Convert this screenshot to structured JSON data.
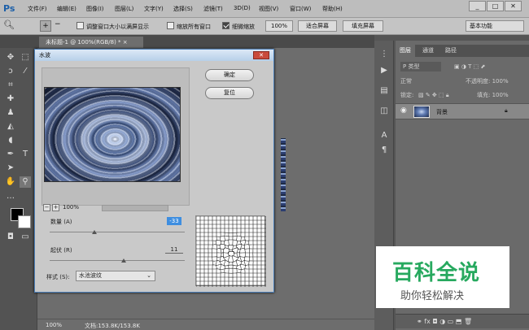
{
  "app": {
    "logo": "Ps"
  },
  "menubar": {
    "items": [
      "文件(F)",
      "编辑(E)",
      "图像(I)",
      "图层(L)",
      "文字(Y)",
      "选择(S)",
      "滤镜(T)",
      "3D(D)",
      "视图(V)",
      "窗口(W)",
      "帮助(H)"
    ],
    "window_buttons": [
      "_",
      "□",
      "✕"
    ]
  },
  "options_bar": {
    "resize_windows": "调整窗口大小以满屏显示",
    "zoom_all": "缩放所有窗口",
    "scrubby_zoom": "细微缩放",
    "zoom_value": "100%",
    "fit_screen": "适合屏幕",
    "fill_screen": "填充屏幕",
    "workspace": "基本功能"
  },
  "document": {
    "tab_title": "未标题-1 @ 100%(RGB/8) *  ×"
  },
  "status_bar": {
    "zoom": "100%",
    "doc_info": "文档:153.8K/153.8K"
  },
  "dialog": {
    "title": "水波",
    "close": "✕",
    "ok_label": "确定",
    "reset_label": "复位",
    "preview_zoom": "100%",
    "amount_label": "数量 (A)",
    "amount_value": "-33",
    "amount_fraction": 0.33,
    "ridges_label": "起伏 (R)",
    "ridges_value": "11",
    "ridges_fraction": 0.55,
    "style_label": "样式 (S):",
    "style_value": "水池波纹"
  },
  "layers_panel": {
    "tabs": [
      "图层",
      "通道",
      "路径"
    ],
    "kind_filter": "P 类型",
    "blend_mode": "正常",
    "opacity": "不透明度: 100%",
    "lock_label": "锁定:",
    "fill": "填充: 100%",
    "layer_name": "背景"
  },
  "watermark": {
    "title": "百科全说",
    "subtitle": "助你轻松解决"
  }
}
